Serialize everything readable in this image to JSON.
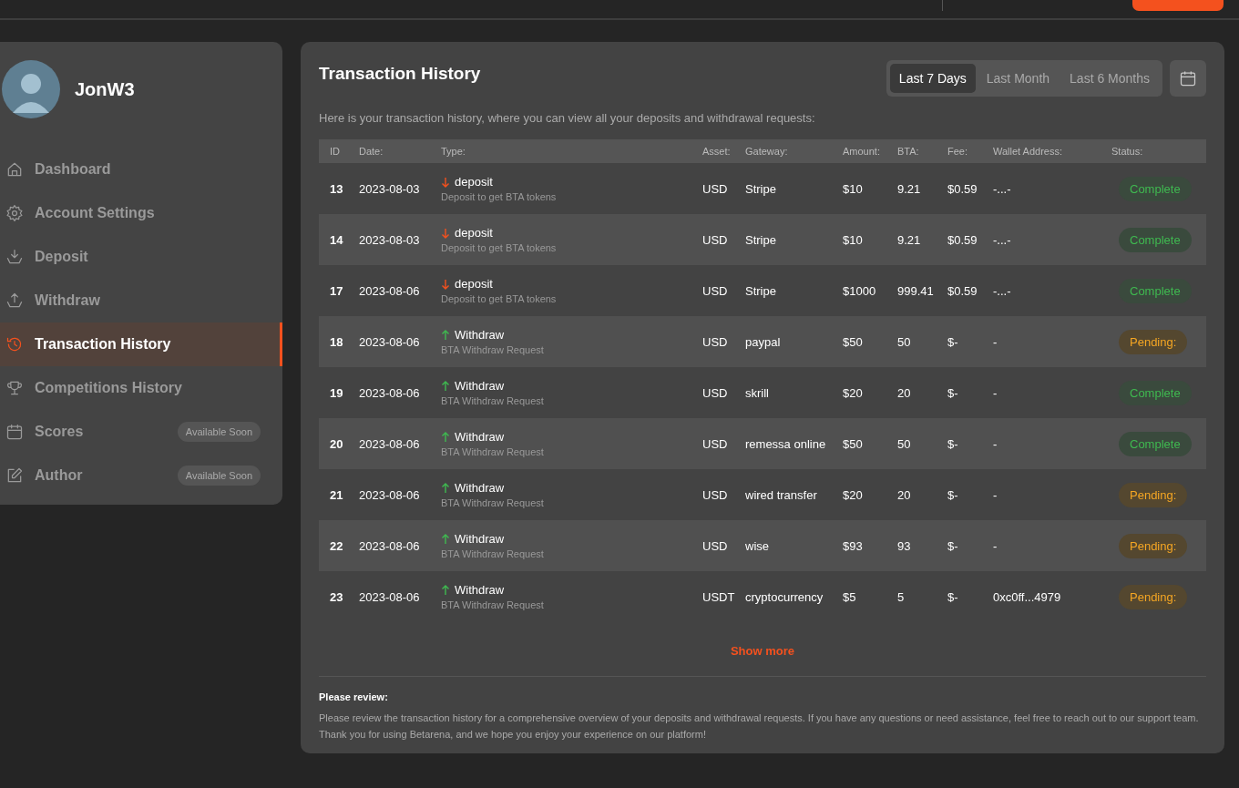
{
  "user": {
    "name": "JonW3"
  },
  "sidebar": {
    "items": [
      {
        "label": "Dashboard",
        "selected": false
      },
      {
        "label": "Account Settings",
        "selected": false
      },
      {
        "label": "Deposit",
        "selected": false
      },
      {
        "label": "Withdraw",
        "selected": false
      },
      {
        "label": "Transaction History",
        "selected": true
      },
      {
        "label": "Competitions History",
        "selected": false
      },
      {
        "label": "Scores",
        "selected": false,
        "badge": "Available Soon"
      },
      {
        "label": "Author",
        "selected": false,
        "badge": "Available Soon"
      }
    ]
  },
  "page": {
    "title": "Transaction History",
    "subtitle": "Here is your transaction history, where you can view all your deposits and withdrawal requests:",
    "ranges": [
      {
        "label": "Last 7 Days",
        "selected": true
      },
      {
        "label": "Last Month",
        "selected": false
      },
      {
        "label": "Last 6 Months",
        "selected": false
      }
    ]
  },
  "table": {
    "columns": [
      "ID",
      "Date:",
      "Type:",
      "Asset:",
      "Gateway:",
      "Amount:",
      "BTA:",
      "Fee:",
      "Wallet Address:",
      "Status:"
    ],
    "rows": [
      {
        "id": "13",
        "date": "2023-08-03",
        "kind": "deposit",
        "type": "deposit",
        "note": "Deposit to get BTA tokens",
        "asset": "USD",
        "gateway": "Stripe",
        "amount": "$10",
        "bta": "9.21",
        "fee": "$0.59",
        "wallet": "-...-",
        "status": {
          "text": "Complete",
          "kind": "complete"
        }
      },
      {
        "id": "14",
        "date": "2023-08-03",
        "kind": "deposit",
        "type": "deposit",
        "note": "Deposit to get BTA tokens",
        "asset": "USD",
        "gateway": "Stripe",
        "amount": "$10",
        "bta": "9.21",
        "fee": "$0.59",
        "wallet": "-...-",
        "status": {
          "text": "Complete",
          "kind": "complete"
        }
      },
      {
        "id": "17",
        "date": "2023-08-06",
        "kind": "deposit",
        "type": "deposit",
        "note": "Deposit to get BTA tokens",
        "asset": "USD",
        "gateway": "Stripe",
        "amount": "$1000",
        "bta": "999.41",
        "fee": "$0.59",
        "wallet": "-...-",
        "status": {
          "text": "Complete",
          "kind": "complete"
        }
      },
      {
        "id": "18",
        "date": "2023-08-06",
        "kind": "withdraw",
        "type": "Withdraw",
        "note": "BTA Withdraw Request",
        "asset": "USD",
        "gateway": "paypal",
        "amount": "$50",
        "bta": "50",
        "fee": "$-",
        "wallet": "-",
        "status": {
          "text": "Pending:",
          "kind": "pending"
        }
      },
      {
        "id": "19",
        "date": "2023-08-06",
        "kind": "withdraw",
        "type": "Withdraw",
        "note": "BTA Withdraw Request",
        "asset": "USD",
        "gateway": "skrill",
        "amount": "$20",
        "bta": "20",
        "fee": "$-",
        "wallet": "-",
        "status": {
          "text": "Complete",
          "kind": "complete"
        }
      },
      {
        "id": "20",
        "date": "2023-08-06",
        "kind": "withdraw",
        "type": "Withdraw",
        "note": "BTA Withdraw Request",
        "asset": "USD",
        "gateway": "remessa online",
        "amount": "$50",
        "bta": "50",
        "fee": "$-",
        "wallet": "-",
        "status": {
          "text": "Complete",
          "kind": "complete"
        }
      },
      {
        "id": "21",
        "date": "2023-08-06",
        "kind": "withdraw",
        "type": "Withdraw",
        "note": "BTA Withdraw Request",
        "asset": "USD",
        "gateway": "wired transfer",
        "amount": "$20",
        "bta": "20",
        "fee": "$-",
        "wallet": "-",
        "status": {
          "text": "Pending:",
          "kind": "pending"
        }
      },
      {
        "id": "22",
        "date": "2023-08-06",
        "kind": "withdraw",
        "type": "Withdraw",
        "note": "BTA Withdraw Request",
        "asset": "USD",
        "gateway": "wise",
        "amount": "$93",
        "bta": "93",
        "fee": "$-",
        "wallet": "-",
        "status": {
          "text": "Pending:",
          "kind": "pending"
        }
      },
      {
        "id": "23",
        "date": "2023-08-06",
        "kind": "withdraw",
        "type": "Withdraw",
        "note": "BTA Withdraw Request",
        "asset": "USDT",
        "gateway": "cryptocurrency",
        "amount": "$5",
        "bta": "5",
        "fee": "$-",
        "wallet": "0xc0ff...4979",
        "status": {
          "text": "Pending:",
          "kind": "pending"
        }
      }
    ]
  },
  "show_more": "Show more",
  "review": {
    "title": "Please review:",
    "text": "Please review the transaction history for a comprehensive overview of your deposits and withdrawal requests. If you have any questions or need assistance, feel free to reach out to our support team. Thank you for using Betarena, and we hope you enjoy your experience on our platform!"
  }
}
